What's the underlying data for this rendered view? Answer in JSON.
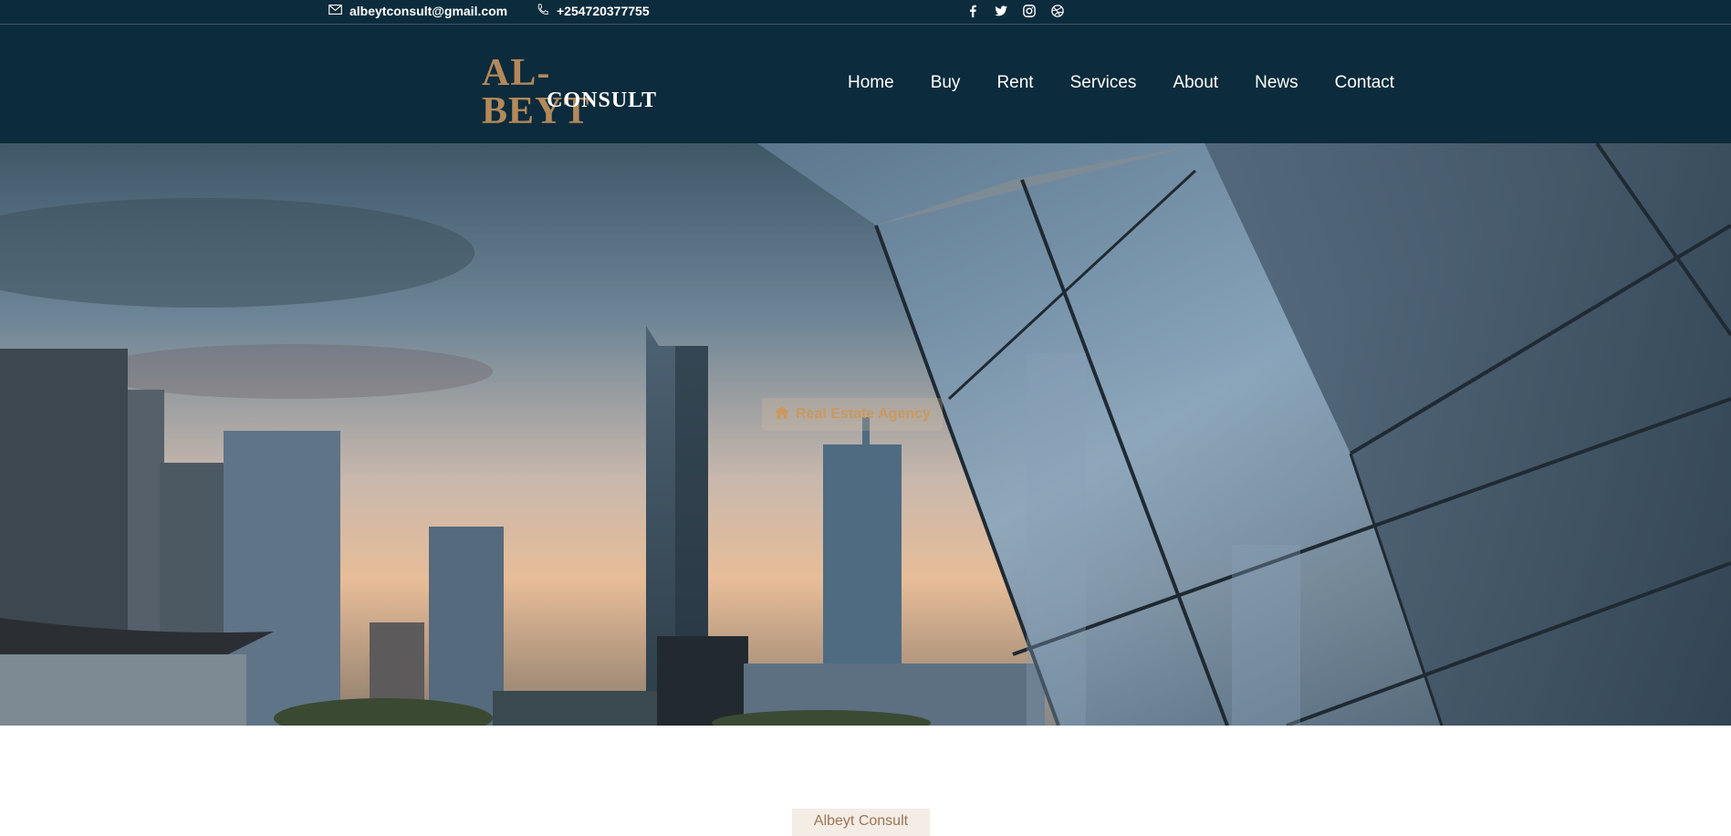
{
  "topbar": {
    "email": "albeytconsult@gmail.com",
    "phone": "+254720377755",
    "email_icon": "envelope-icon",
    "phone_icon": "phone-icon",
    "social": [
      "facebook-icon",
      "twitter-icon",
      "instagram-icon",
      "dribbble-icon"
    ]
  },
  "logo": {
    "line1": "AL-BEYT",
    "line2": "CONSULT"
  },
  "nav": {
    "items": [
      "Home",
      "Buy",
      "Rent",
      "Services",
      "About",
      "News",
      "Contact"
    ]
  },
  "hero": {
    "badge": "Real Estate Agency",
    "badge_icon": "home-icon"
  },
  "section": {
    "label": "Albeyt Consult"
  },
  "colors": {
    "navy": "#0c2b3c",
    "gold": "#b4895a",
    "badge_text": "#c9995f",
    "section_bg": "#f4ede6"
  }
}
